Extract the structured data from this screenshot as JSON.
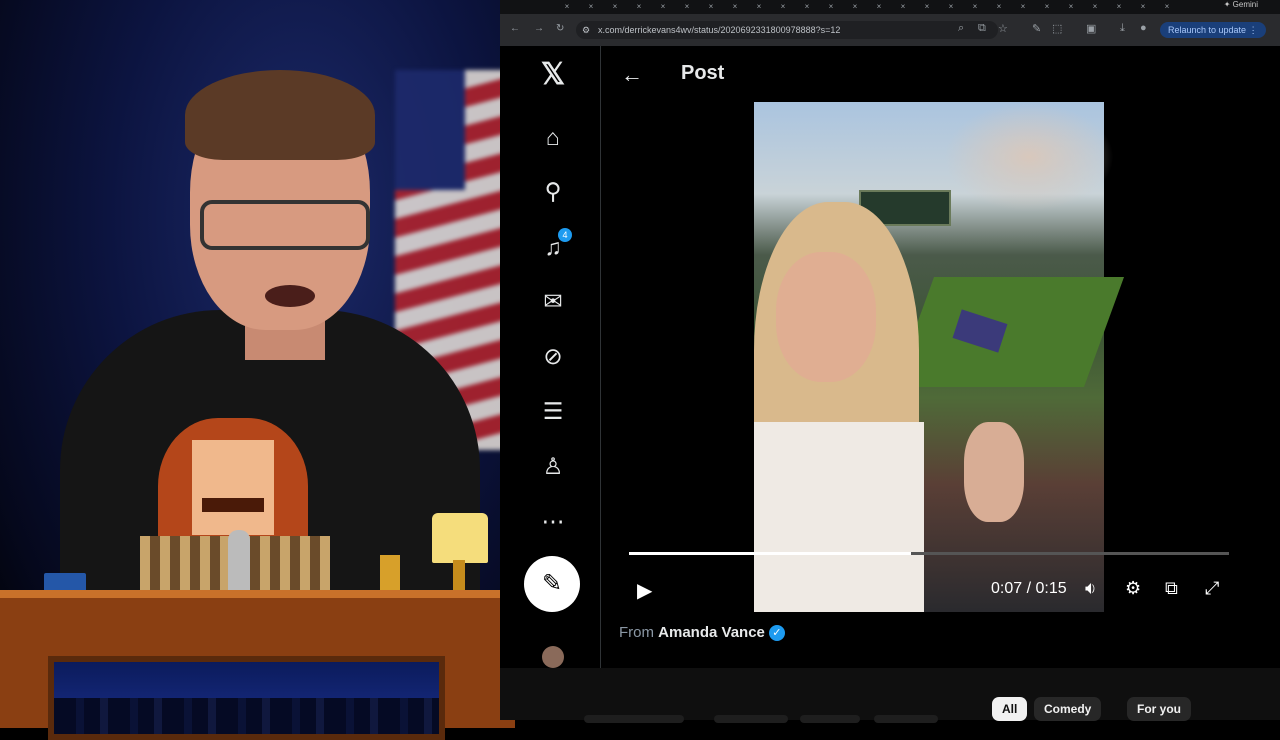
{
  "browser": {
    "url": "x.com/derrickevans4wv/status/2020692331800978888?s=12",
    "relaunch_label": "Relaunch to update",
    "gemini_label": "Gemini",
    "tab_count": 26
  },
  "x": {
    "post_title": "Post",
    "notifications_count": "4",
    "nav": [
      "home-icon",
      "search-icon",
      "bell-icon",
      "mail-icon",
      "grok-icon",
      "notes-icon",
      "profile-icon",
      "more-icon"
    ],
    "video": {
      "time": "0:07 / 0:15",
      "progress": 0.47
    },
    "from_label": "From",
    "from_name": "Amanda Vance"
  },
  "youtube": {
    "chips": [
      "All",
      "Comedy",
      "For you"
    ]
  },
  "colors": {
    "x_blue": "#1d9bf0",
    "relaunch_bg": "#1a3f7a"
  }
}
